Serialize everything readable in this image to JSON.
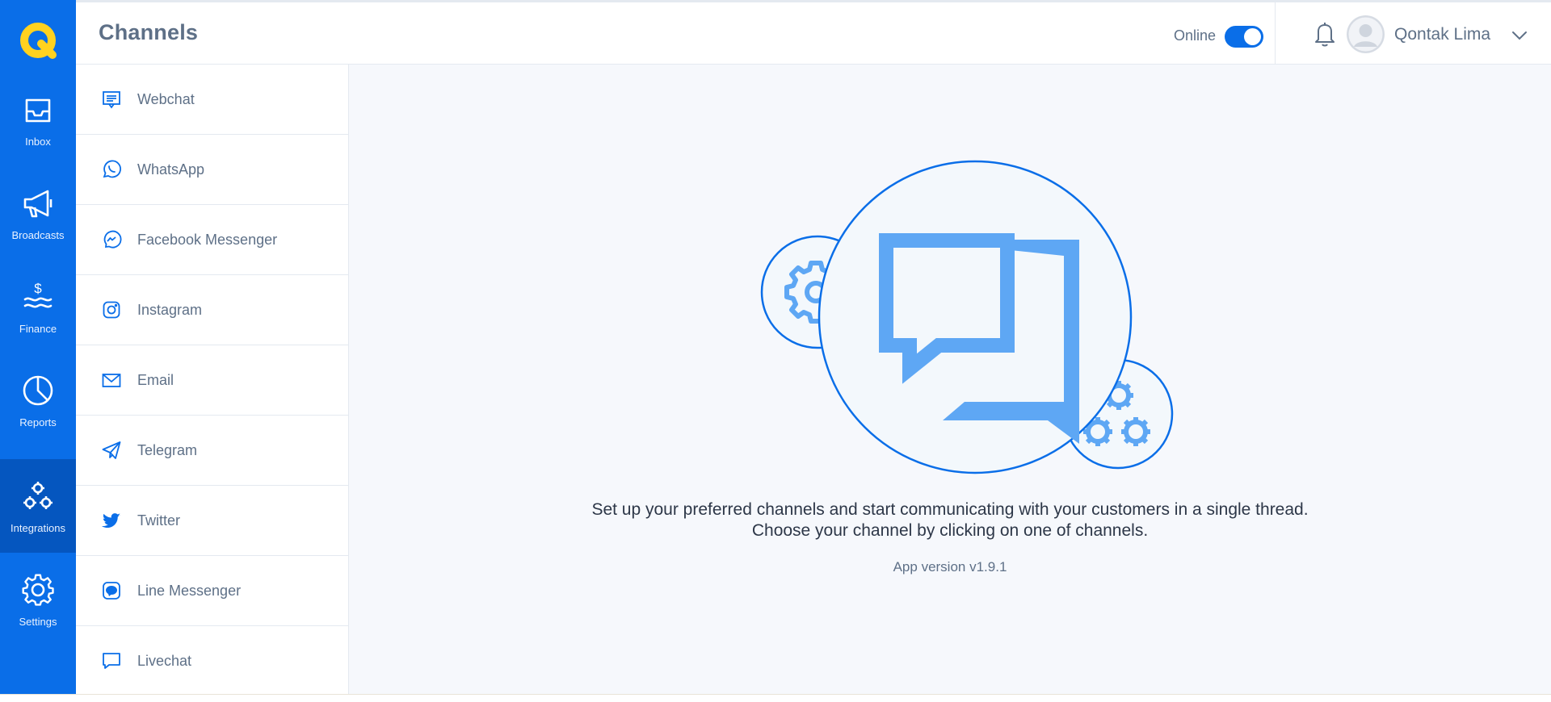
{
  "app": {
    "brand_color": "#0a6ee8",
    "logo_color": "#ffd21f"
  },
  "nav": {
    "items": [
      {
        "label": "Inbox",
        "icon": "inbox-icon"
      },
      {
        "label": "Broadcasts",
        "icon": "megaphone-icon"
      },
      {
        "label": "Finance",
        "icon": "finance-icon"
      },
      {
        "label": "Reports",
        "icon": "pie-chart-icon"
      },
      {
        "label": "Integrations",
        "icon": "integrations-icon",
        "active": true
      },
      {
        "label": "Settings",
        "icon": "gear-icon"
      }
    ]
  },
  "header": {
    "title": "Channels",
    "status_label": "Online",
    "status_on": true,
    "user_name": "Qontak Lima"
  },
  "channels": {
    "items": [
      {
        "label": "Webchat",
        "icon": "webchat-icon"
      },
      {
        "label": "WhatsApp",
        "icon": "whatsapp-icon"
      },
      {
        "label": "Facebook Messenger",
        "icon": "messenger-icon"
      },
      {
        "label": "Instagram",
        "icon": "instagram-icon"
      },
      {
        "label": "Email",
        "icon": "email-icon"
      },
      {
        "label": "Telegram",
        "icon": "telegram-icon"
      },
      {
        "label": "Twitter",
        "icon": "twitter-icon"
      },
      {
        "label": "Line Messenger",
        "icon": "line-icon"
      },
      {
        "label": "Livechat",
        "icon": "livechat-icon"
      }
    ]
  },
  "main": {
    "message_line1": "Set up your preferred channels and start communicating with your customers in a single thread.",
    "message_line2": "Choose your channel by clicking on one of channels.",
    "version": "App version v1.9.1"
  }
}
